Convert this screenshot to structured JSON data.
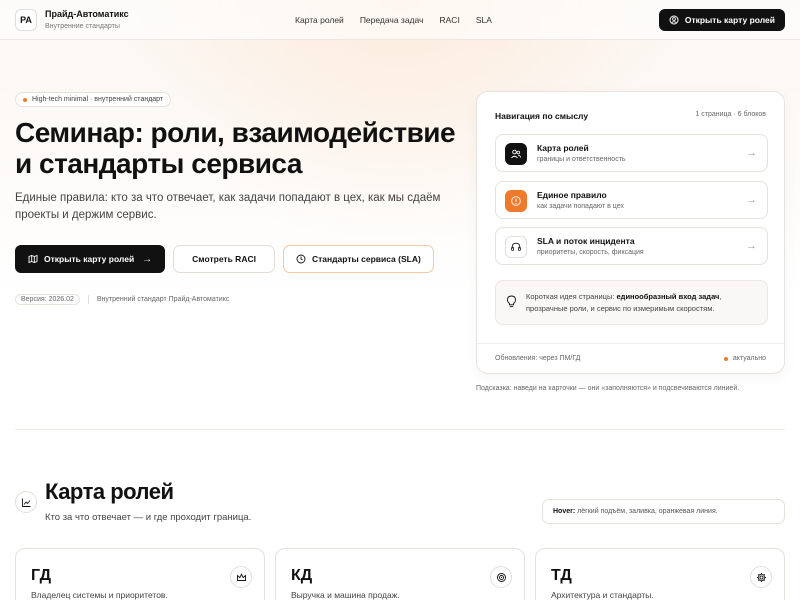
{
  "header": {
    "logo": "PA",
    "brand_name": "Прайд-Автоматикс",
    "brand_sub": "Внутренние стандарты",
    "nav": [
      "Карта ролей",
      "Передача задач",
      "RACI",
      "SLA"
    ],
    "cta_label": "Открыть карту ролей"
  },
  "hero": {
    "pill": "High-tech minimal · внутренний стандарт",
    "title": "Семинар: роли, взаимодействие и стандарты сервиса",
    "subtitle": "Единые правила: кто за что отвечает, как задачи попадают в цех, как мы сдаём проекты и держим сервис.",
    "btn_roles": "Открыть карту ролей",
    "btn_raci": "Смотреть RACI",
    "btn_sla": "Стандарты сервиса (SLA)",
    "version": "Версия: 2026.02",
    "standard": "Внутренний стандарт Прайд-Автоматикс"
  },
  "panel": {
    "title": "Навигация по смыслу",
    "count": "1 страница · 6 блоков",
    "cards": [
      {
        "title": "Карта ролей",
        "sub": "границы и ответственность",
        "icon": "users-icon"
      },
      {
        "title": "Единое правило",
        "sub": "как задачи попадают в цех",
        "icon": "alert-icon"
      },
      {
        "title": "SLA и поток инцидента",
        "sub": "приоритеты, скорость, фиксация",
        "icon": "headset-icon"
      }
    ],
    "idea_prefix": "Короткая идея страницы: ",
    "idea_bold": "единообразный вход задач",
    "idea_suffix": ", прозрачные роли, и сервис по измеримым скоростям.",
    "footer_left": "Обновления: через ПМ/ГД",
    "footer_right": "актуально"
  },
  "hint": "Подсказка: наведи на карточки — они «заполняются» и подсвечиваются линией.",
  "roles": {
    "title": "Карта ролей",
    "subtitle": "Кто за что отвечает — и где проходит граница.",
    "hover_label": "Hover:",
    "hover_text": "лёгкий подъём, заливка, оранжевая линия.",
    "cards": [
      {
        "title": "ГД",
        "sub": "Владелец системы и приоритетов.",
        "icon": "crown-icon"
      },
      {
        "title": "КД",
        "sub": "Выручка и машина продаж.",
        "icon": "target-icon"
      },
      {
        "title": "ТД",
        "sub": "Архитектура и стандарты.",
        "icon": "gear-icon"
      }
    ]
  },
  "colors": {
    "accent": "#f07a2b",
    "dark": "#111111"
  }
}
